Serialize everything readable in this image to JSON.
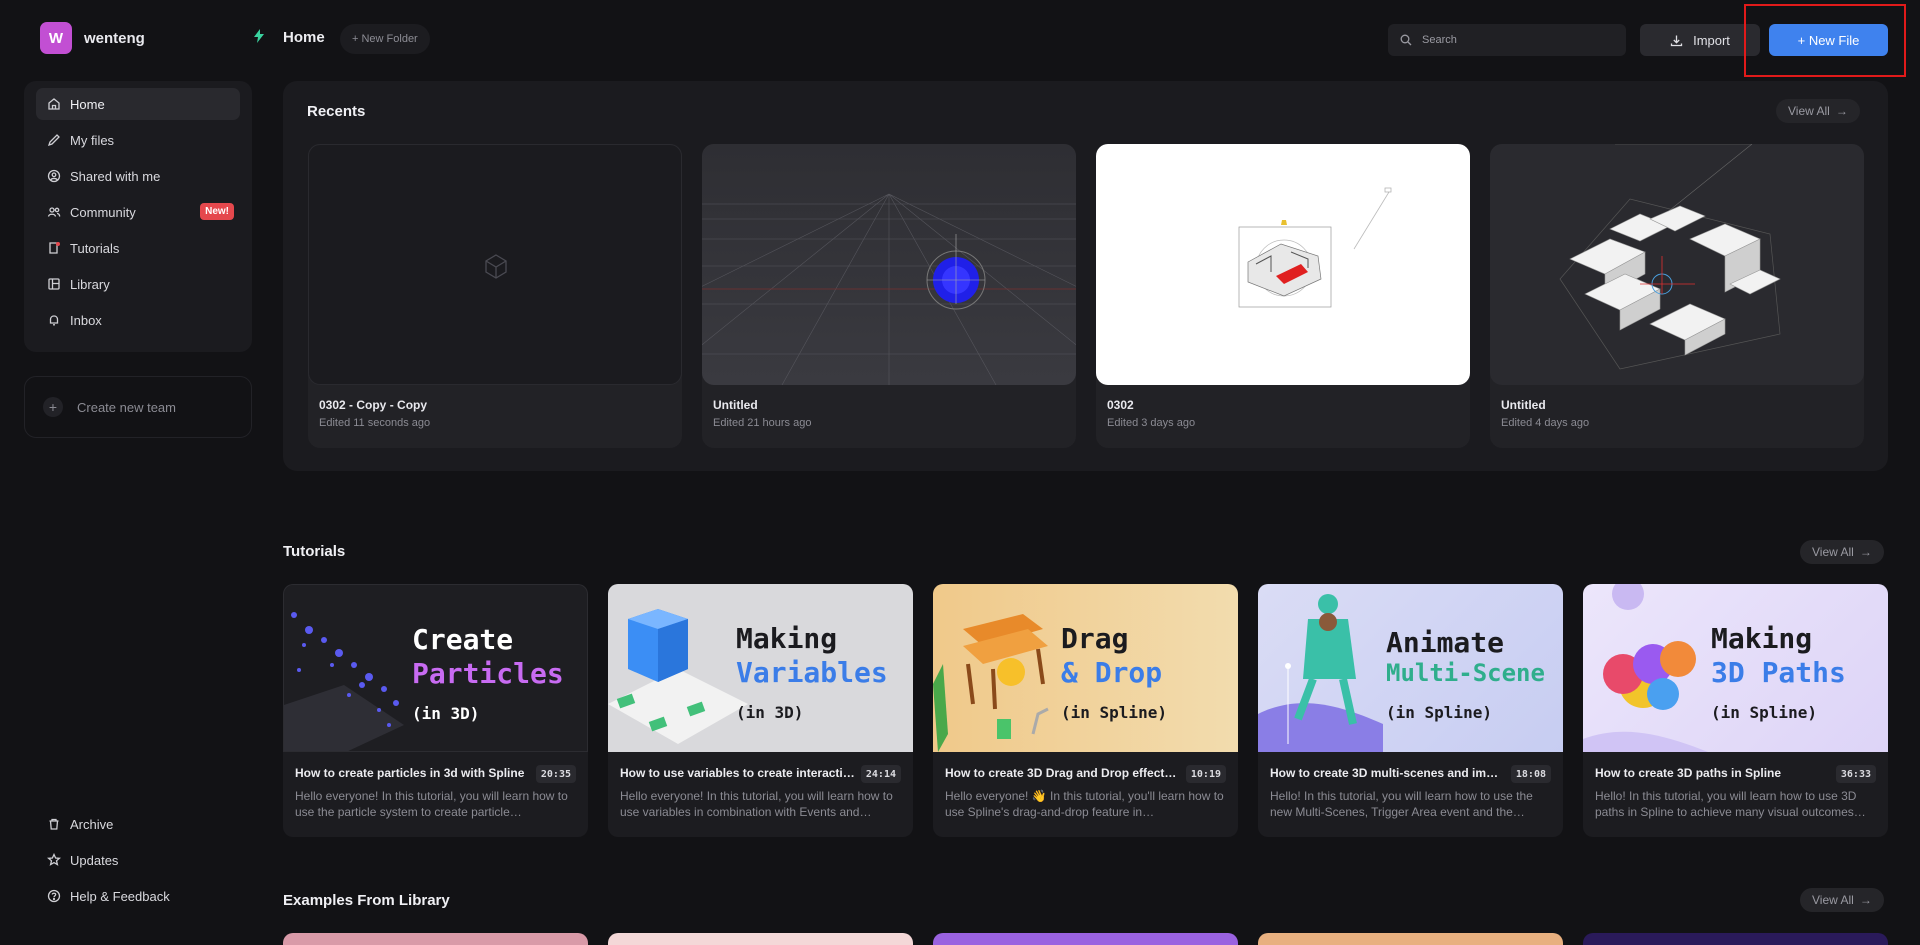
{
  "user": {
    "initial": "W",
    "name": "wenteng"
  },
  "nav": [
    {
      "label": "Home",
      "icon": "home-icon"
    },
    {
      "label": "My files",
      "icon": "pencil-icon"
    },
    {
      "label": "Shared with me",
      "icon": "user-circle-icon"
    },
    {
      "label": "Community",
      "icon": "users-icon",
      "badge": "New!"
    },
    {
      "label": "Tutorials",
      "icon": "book-icon"
    },
    {
      "label": "Library",
      "icon": "library-icon"
    },
    {
      "label": "Inbox",
      "icon": "bell-icon"
    }
  ],
  "team": {
    "create_label": "Create new team"
  },
  "bottom_nav": [
    {
      "label": "Archive",
      "icon": "trash-icon"
    },
    {
      "label": "Updates",
      "icon": "star-icon"
    },
    {
      "label": "Help & Feedback",
      "icon": "help-icon"
    }
  ],
  "header": {
    "title": "Home",
    "new_folder": "+ New Folder",
    "search_placeholder": "Search",
    "import_label": "Import",
    "new_file_label": "+ New File"
  },
  "recents": {
    "title": "Recents",
    "view_all": "View All",
    "items": [
      {
        "name": "0302 - Copy - Copy",
        "edited": "Edited 11 seconds ago"
      },
      {
        "name": "Untitled",
        "edited": "Edited 21 hours ago"
      },
      {
        "name": "0302",
        "edited": "Edited 3 days ago"
      },
      {
        "name": "Untitled",
        "edited": "Edited 4 days ago"
      }
    ]
  },
  "tutorials": {
    "title": "Tutorials",
    "view_all": "View All",
    "items": [
      {
        "l1": "Create",
        "l2": "Particles",
        "l3": "(in 3D)",
        "title": "How to create particles in 3d with Spline",
        "duration": "20:35",
        "desc": "Hello everyone! In this tutorial, you will learn how to use the particle system to create particle…"
      },
      {
        "l1": "Making",
        "l2": "Variables",
        "l3": "(in 3D)",
        "title": "How to use variables to create interacti…",
        "duration": "24:14",
        "desc": "Hello everyone! In this tutorial, you will learn how to use variables in combination with Events and…"
      },
      {
        "l1": "Drag",
        "l2": "& Drop",
        "l3": "(in Spline)",
        "title": "How to create 3D Drag and Drop effects…",
        "duration": "10:19",
        "desc": "Hello everyone! 👋 In this tutorial, you'll learn how to use Spline's drag-and-drop feature in…"
      },
      {
        "l1": "Animate",
        "l2": "Multi-Scene",
        "l3": "(in Spline)",
        "title": "How to create 3D multi-scenes and imp…",
        "duration": "18:08",
        "desc": "Hello! In this tutorial, you will learn how to use the new Multi-Scenes, Trigger Area event and the…"
      },
      {
        "l1": "Making",
        "l2": "3D Paths",
        "l3": "(in Spline)",
        "title": "How to create 3D paths in Spline",
        "duration": "36:33",
        "desc": "Hello! In this tutorial, you will learn how to use 3D paths in Spline to achieve many visual outcomes…"
      }
    ]
  },
  "library": {
    "title": "Examples From Library",
    "view_all": "View All"
  },
  "colors": {
    "accent": "#3f82ee",
    "avatar": "#c24fd3",
    "badge": "#e5484d",
    "highlight": "#e11a1a"
  }
}
